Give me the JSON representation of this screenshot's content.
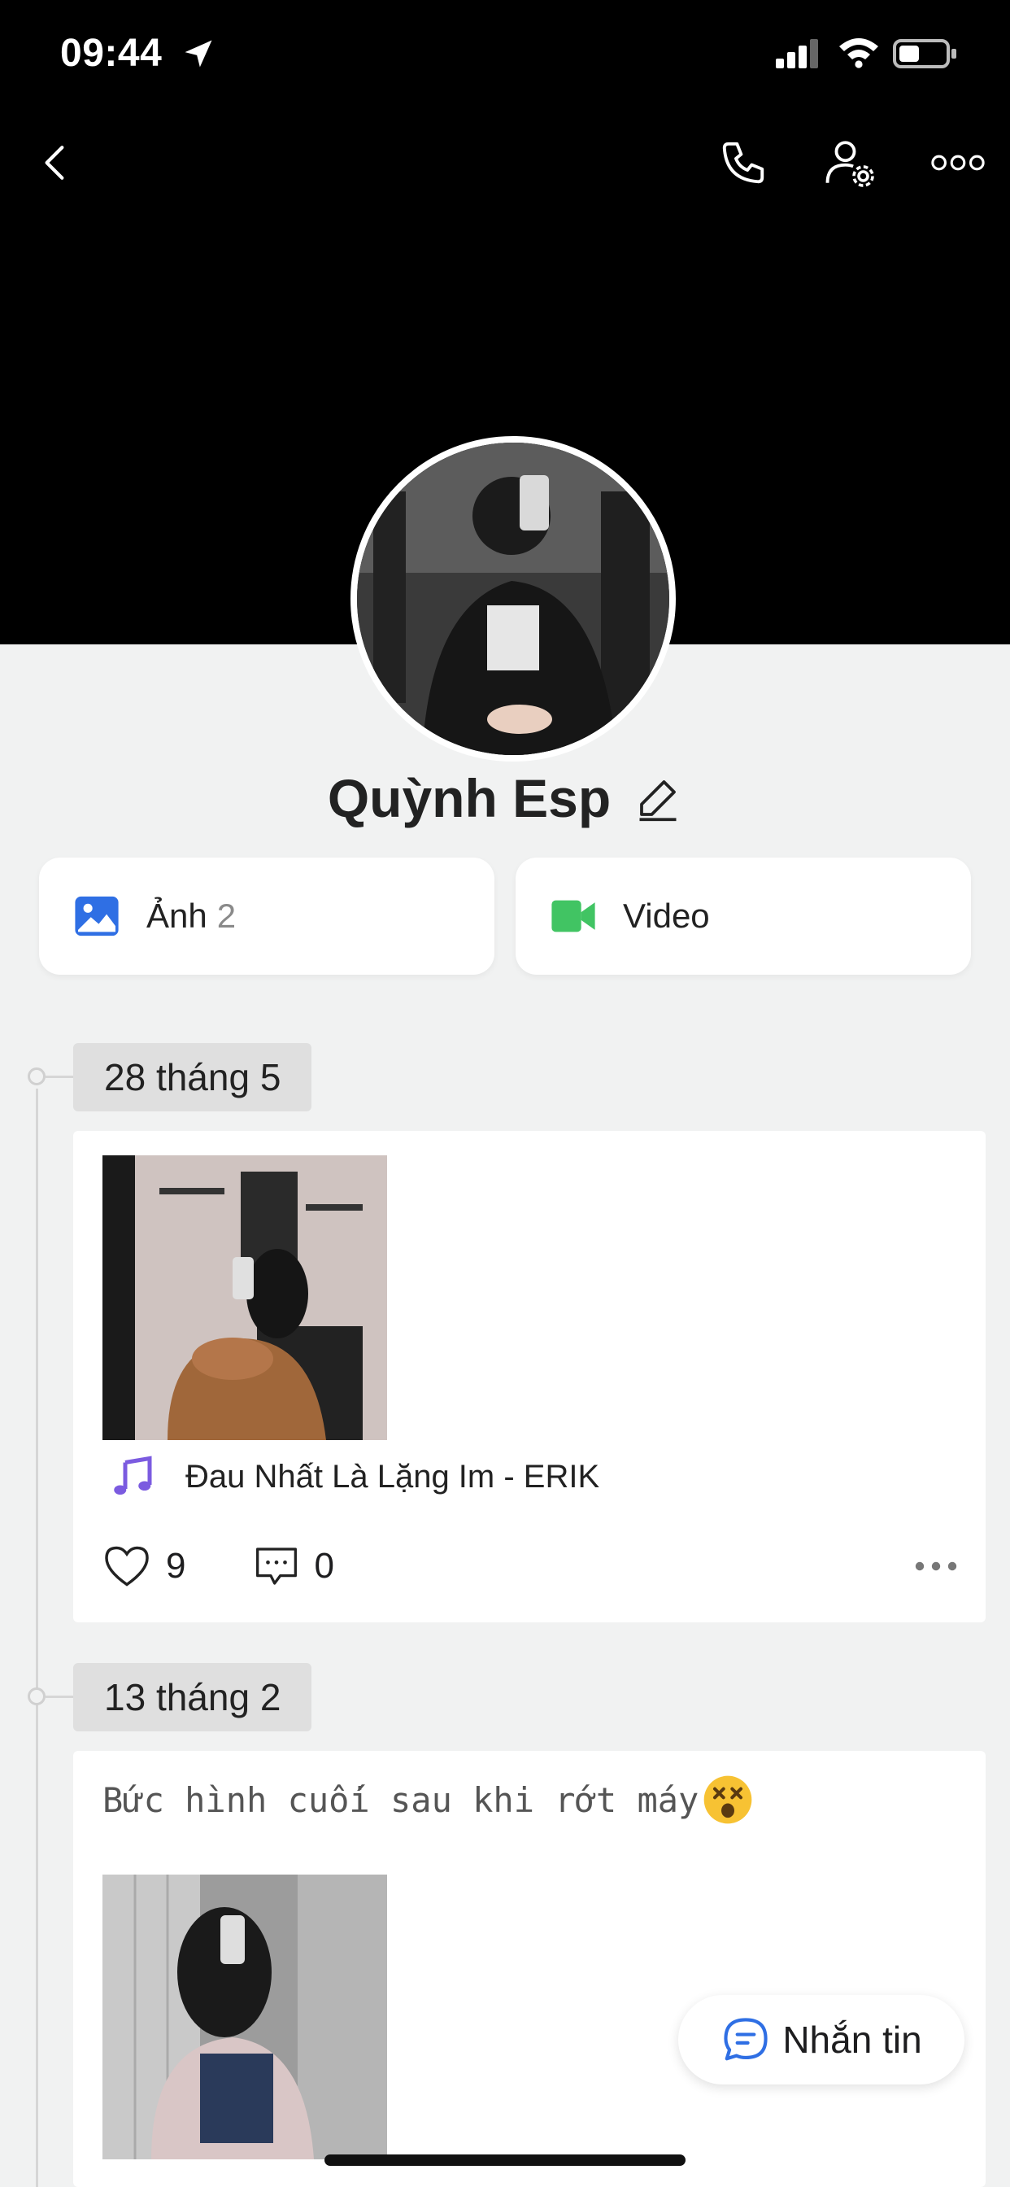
{
  "status_bar": {
    "time": "09:44"
  },
  "colors": {
    "photo_icon": "#2f6fe4",
    "video_icon": "#41c463",
    "music_icon": "#7b5be0",
    "chat_icon": "#2f6fe4"
  },
  "profile": {
    "name": "Quỳnh Esp"
  },
  "media": {
    "photos_label": "Ảnh",
    "photos_count": "2",
    "videos_label": "Video"
  },
  "timeline": [
    {
      "date": "28 tháng 5",
      "music": "Đau Nhất Là Lặng Im - ERIK",
      "likes": "9",
      "comments": "0"
    },
    {
      "date": "13 tháng 2",
      "caption": "Bức hình cuối sau khi rớt máy"
    }
  ],
  "fab": {
    "label": "Nhắn tin"
  }
}
